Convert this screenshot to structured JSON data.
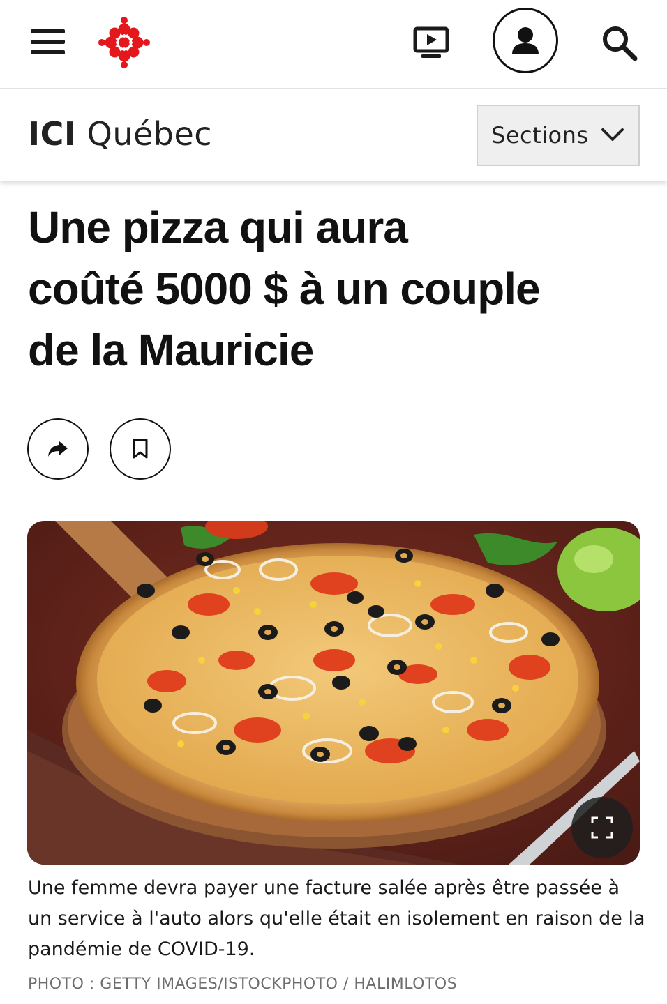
{
  "header": {
    "menu_icon": "hamburger-icon",
    "logo_icon": "radio-canada-gem-logo",
    "tv_icon": "tv-play-icon",
    "account_icon": "user-icon",
    "search_icon": "search-icon"
  },
  "section_bar": {
    "brand_bold": "ICI",
    "brand_region": "Québec",
    "sections_label": "Sections",
    "sections_icon": "chevron-down-icon"
  },
  "article": {
    "headline_lines": [
      "Une pizza qui aura",
      "coûté 5000 $ à un couple",
      "de la Mauricie"
    ],
    "share_icon": "share-arrow-icon",
    "bookmark_icon": "bookmark-icon",
    "photo": {
      "subject": "pizza",
      "expand_icon": "fullscreen-icon",
      "caption": "Une femme devra payer une facture salée après être passée à un service à l'auto alors qu'elle était en isolement en raison de la pandémie de COVID-19.",
      "credit": "PHOTO : GETTY IMAGES/ISTOCKPHOTO / HALIMLOTOS"
    }
  },
  "colors": {
    "brand_red": "#e4171d",
    "text": "#111111",
    "credit_gray": "#6d6d6d"
  }
}
